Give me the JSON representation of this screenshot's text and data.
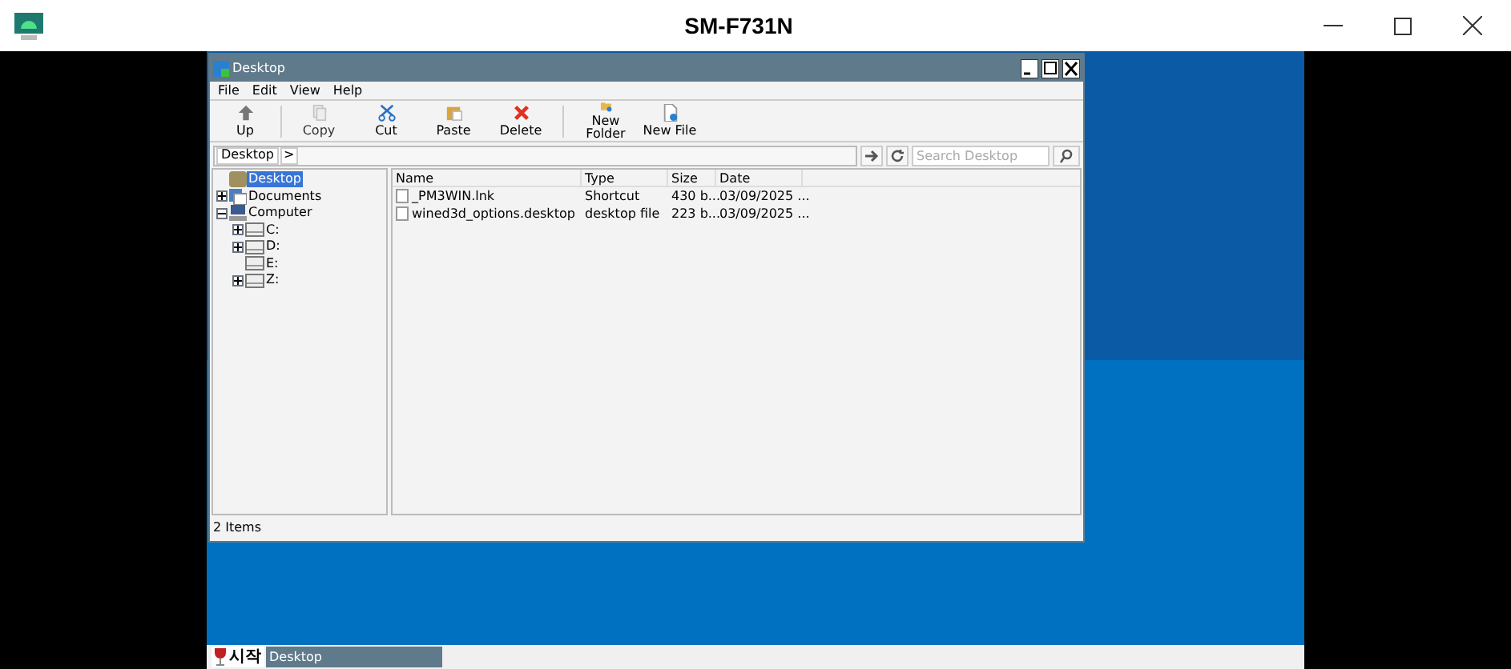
{
  "window": {
    "title": "SM-F731N"
  },
  "explorer": {
    "title": "Desktop",
    "menu": [
      "File",
      "Edit",
      "View",
      "Help"
    ],
    "toolbar": [
      {
        "label": "Up",
        "kind": "up"
      },
      {
        "label": "Copy",
        "kind": "copy",
        "disabled": true
      },
      {
        "label": "Cut",
        "kind": "cut",
        "disabled": false
      },
      {
        "label": "Paste",
        "kind": "paste",
        "disabled": false
      },
      {
        "label": "Delete",
        "kind": "delete",
        "disabled": false
      },
      {
        "label": "New Folder",
        "kind": "folder",
        "disabled": false
      },
      {
        "label": "New File",
        "kind": "file",
        "disabled": false
      }
    ],
    "address": {
      "crumb": "Desktop",
      "separator": ">"
    },
    "search": {
      "placeholder": "Search Desktop"
    },
    "tree": [
      {
        "label": "Desktop",
        "kind": "desktop",
        "selected": true
      },
      {
        "label": "Documents",
        "kind": "documents",
        "selected": false,
        "expanded": false
      },
      {
        "label": "Computer",
        "kind": "computer",
        "selected": false,
        "expanded": true,
        "children": [
          {
            "label": "C:",
            "kind": "drive",
            "selected": false,
            "expanded": false
          },
          {
            "label": "D:",
            "kind": "drive",
            "selected": false,
            "expanded": false
          },
          {
            "label": "E:",
            "kind": "drive",
            "selected": false
          },
          {
            "label": "Z:",
            "kind": "drive",
            "selected": false,
            "expanded": false
          }
        ]
      }
    ],
    "columns": [
      "Name",
      "Type",
      "Size",
      "Date"
    ],
    "rows": [
      {
        "name": "_PM3WIN.lnk",
        "type": "Shortcut",
        "size": "430 b...",
        "date": "03/09/2025 ..."
      },
      {
        "name": "wined3d_options.desktop",
        "type": "desktop file",
        "size": "223 b...",
        "date": "03/09/2025 ..."
      }
    ],
    "status": "2 Items"
  },
  "taskbar": {
    "start": "시작",
    "tasks": [
      "Desktop"
    ]
  }
}
